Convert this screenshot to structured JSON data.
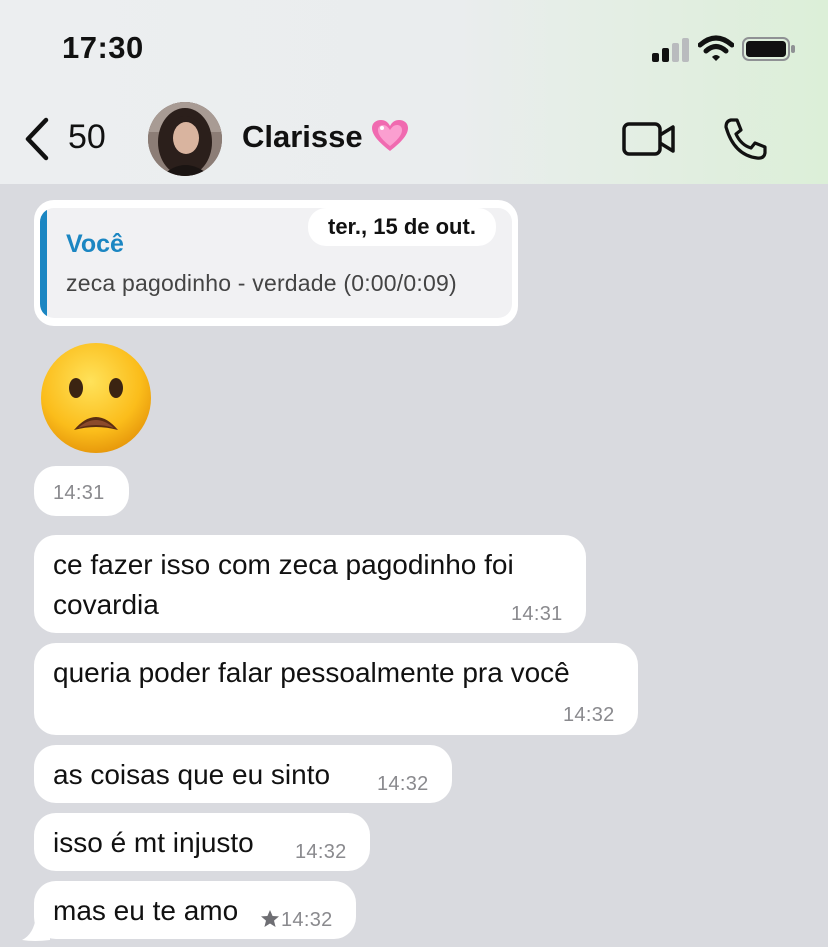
{
  "status_bar": {
    "time": "17:30"
  },
  "header": {
    "back_count": "50",
    "contact_name": "Clarisse",
    "name_emoji": "💗"
  },
  "chat": {
    "reply": {
      "author": "Você",
      "text": "zeca pagodinho - verdade (0:00/0:09)",
      "date": "ter., 15 de out."
    },
    "emoji_message": {
      "emoji": "😦",
      "time": "14:31"
    },
    "messages": [
      {
        "lines": [
          "ce fazer isso com zeca pagodinho foi",
          "covardia"
        ],
        "time": "14:31"
      },
      {
        "lines": [
          "queria poder falar pessoalmente pra você"
        ],
        "time": "14:32"
      },
      {
        "lines": [
          "as coisas que eu sinto"
        ],
        "time": "14:32"
      },
      {
        "lines": [
          "isso é mt injusto"
        ],
        "time": "14:32"
      },
      {
        "lines": [
          "mas eu te amo"
        ],
        "time": "14:32",
        "starred": true
      }
    ]
  },
  "colors": {
    "chat_background": "#d9dadf",
    "bubble": "#ffffff",
    "reply_accent": "#1b86c2",
    "timestamp": "#8a8a8e"
  },
  "icons": [
    "signal-icon",
    "wifi-icon",
    "battery-icon",
    "back-chevron-icon",
    "video-call-icon",
    "phone-icon",
    "star-icon"
  ]
}
